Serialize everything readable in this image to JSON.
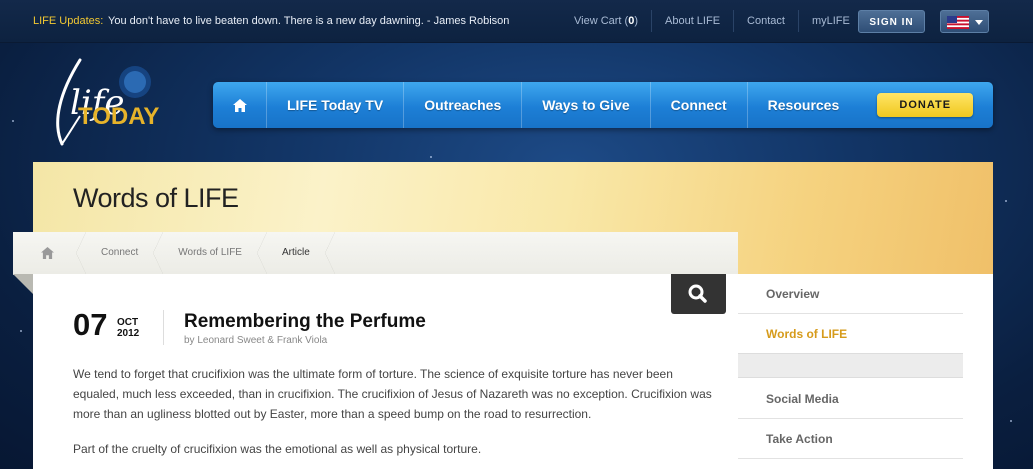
{
  "topbar": {
    "updates_label": "LIFE Updates:",
    "updates_text": "You don't have to live beaten down. There is a new day dawning. - James Robison",
    "view_cart_label": "View Cart (",
    "cart_count": "0",
    "cart_close": ")",
    "about_label": "About LIFE",
    "contact_label": "Contact",
    "mylife_label": "myLIFE",
    "signin_label": "SIGN IN",
    "flag_icon": "us-flag-icon"
  },
  "logo": {
    "text_life": "life",
    "text_today": "TODAY"
  },
  "nav": {
    "home_icon": "home-icon",
    "items": [
      "LIFE Today TV",
      "Outreaches",
      "Ways to Give",
      "Connect",
      "Resources"
    ],
    "donate_label": "DONATE"
  },
  "hero": {
    "title": "Words of LIFE"
  },
  "breadcrumb": {
    "items": [
      "Connect",
      "Words of LIFE",
      "Article"
    ]
  },
  "article": {
    "day": "07",
    "month": "OCT",
    "year": "2012",
    "title": "Remembering the Perfume",
    "byline": "by Leonard Sweet & Frank Viola",
    "paragraphs": [
      "We tend to forget that crucifixion was the ultimate form of torture. The science of exquisite torture has never been equaled, much less exceeded, than in crucifixion. The crucifixion of Jesus of Nazareth was no exception. Crucifixion was more than an ugliness blotted out by Easter, more than a speed bump on the road to resurrection.",
      "Part of the cruelty of crucifixion was the emotional as well as physical torture."
    ]
  },
  "sidebar": {
    "items": [
      "Overview",
      "Words of LIFE",
      "Social Media",
      "Take Action"
    ]
  },
  "colors": {
    "accent": "#d69b1b",
    "nav_blue": "#1d7fd6",
    "donate": "#f0c81e",
    "updates": "#f2c832"
  }
}
